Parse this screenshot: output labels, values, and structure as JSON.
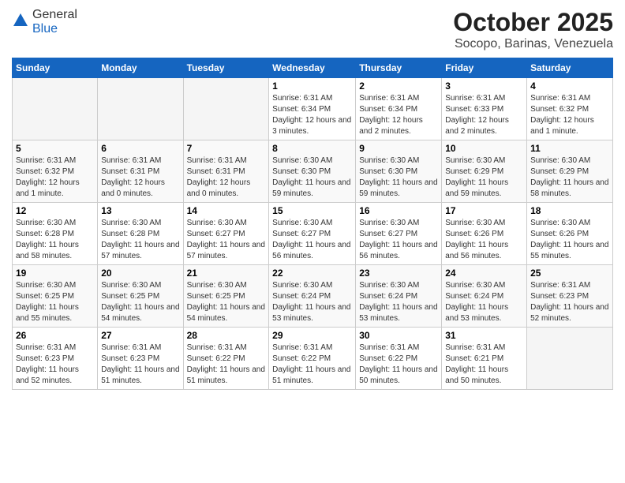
{
  "header": {
    "logo_general": "General",
    "logo_blue": "Blue",
    "month_title": "October 2025",
    "subtitle": "Socopo, Barinas, Venezuela"
  },
  "weekdays": [
    "Sunday",
    "Monday",
    "Tuesday",
    "Wednesday",
    "Thursday",
    "Friday",
    "Saturday"
  ],
  "weeks": [
    [
      {
        "day": "",
        "info": "",
        "empty": true
      },
      {
        "day": "",
        "info": "",
        "empty": true
      },
      {
        "day": "",
        "info": "",
        "empty": true
      },
      {
        "day": "1",
        "info": "Sunrise: 6:31 AM\nSunset: 6:34 PM\nDaylight: 12 hours and 3 minutes.",
        "empty": false
      },
      {
        "day": "2",
        "info": "Sunrise: 6:31 AM\nSunset: 6:34 PM\nDaylight: 12 hours and 2 minutes.",
        "empty": false
      },
      {
        "day": "3",
        "info": "Sunrise: 6:31 AM\nSunset: 6:33 PM\nDaylight: 12 hours and 2 minutes.",
        "empty": false
      },
      {
        "day": "4",
        "info": "Sunrise: 6:31 AM\nSunset: 6:32 PM\nDaylight: 12 hours and 1 minute.",
        "empty": false
      }
    ],
    [
      {
        "day": "5",
        "info": "Sunrise: 6:31 AM\nSunset: 6:32 PM\nDaylight: 12 hours and 1 minute.",
        "empty": false
      },
      {
        "day": "6",
        "info": "Sunrise: 6:31 AM\nSunset: 6:31 PM\nDaylight: 12 hours and 0 minutes.",
        "empty": false
      },
      {
        "day": "7",
        "info": "Sunrise: 6:31 AM\nSunset: 6:31 PM\nDaylight: 12 hours and 0 minutes.",
        "empty": false
      },
      {
        "day": "8",
        "info": "Sunrise: 6:30 AM\nSunset: 6:30 PM\nDaylight: 11 hours and 59 minutes.",
        "empty": false
      },
      {
        "day": "9",
        "info": "Sunrise: 6:30 AM\nSunset: 6:30 PM\nDaylight: 11 hours and 59 minutes.",
        "empty": false
      },
      {
        "day": "10",
        "info": "Sunrise: 6:30 AM\nSunset: 6:29 PM\nDaylight: 11 hours and 59 minutes.",
        "empty": false
      },
      {
        "day": "11",
        "info": "Sunrise: 6:30 AM\nSunset: 6:29 PM\nDaylight: 11 hours and 58 minutes.",
        "empty": false
      }
    ],
    [
      {
        "day": "12",
        "info": "Sunrise: 6:30 AM\nSunset: 6:28 PM\nDaylight: 11 hours and 58 minutes.",
        "empty": false
      },
      {
        "day": "13",
        "info": "Sunrise: 6:30 AM\nSunset: 6:28 PM\nDaylight: 11 hours and 57 minutes.",
        "empty": false
      },
      {
        "day": "14",
        "info": "Sunrise: 6:30 AM\nSunset: 6:27 PM\nDaylight: 11 hours and 57 minutes.",
        "empty": false
      },
      {
        "day": "15",
        "info": "Sunrise: 6:30 AM\nSunset: 6:27 PM\nDaylight: 11 hours and 56 minutes.",
        "empty": false
      },
      {
        "day": "16",
        "info": "Sunrise: 6:30 AM\nSunset: 6:27 PM\nDaylight: 11 hours and 56 minutes.",
        "empty": false
      },
      {
        "day": "17",
        "info": "Sunrise: 6:30 AM\nSunset: 6:26 PM\nDaylight: 11 hours and 56 minutes.",
        "empty": false
      },
      {
        "day": "18",
        "info": "Sunrise: 6:30 AM\nSunset: 6:26 PM\nDaylight: 11 hours and 55 minutes.",
        "empty": false
      }
    ],
    [
      {
        "day": "19",
        "info": "Sunrise: 6:30 AM\nSunset: 6:25 PM\nDaylight: 11 hours and 55 minutes.",
        "empty": false
      },
      {
        "day": "20",
        "info": "Sunrise: 6:30 AM\nSunset: 6:25 PM\nDaylight: 11 hours and 54 minutes.",
        "empty": false
      },
      {
        "day": "21",
        "info": "Sunrise: 6:30 AM\nSunset: 6:25 PM\nDaylight: 11 hours and 54 minutes.",
        "empty": false
      },
      {
        "day": "22",
        "info": "Sunrise: 6:30 AM\nSunset: 6:24 PM\nDaylight: 11 hours and 53 minutes.",
        "empty": false
      },
      {
        "day": "23",
        "info": "Sunrise: 6:30 AM\nSunset: 6:24 PM\nDaylight: 11 hours and 53 minutes.",
        "empty": false
      },
      {
        "day": "24",
        "info": "Sunrise: 6:30 AM\nSunset: 6:24 PM\nDaylight: 11 hours and 53 minutes.",
        "empty": false
      },
      {
        "day": "25",
        "info": "Sunrise: 6:31 AM\nSunset: 6:23 PM\nDaylight: 11 hours and 52 minutes.",
        "empty": false
      }
    ],
    [
      {
        "day": "26",
        "info": "Sunrise: 6:31 AM\nSunset: 6:23 PM\nDaylight: 11 hours and 52 minutes.",
        "empty": false
      },
      {
        "day": "27",
        "info": "Sunrise: 6:31 AM\nSunset: 6:23 PM\nDaylight: 11 hours and 51 minutes.",
        "empty": false
      },
      {
        "day": "28",
        "info": "Sunrise: 6:31 AM\nSunset: 6:22 PM\nDaylight: 11 hours and 51 minutes.",
        "empty": false
      },
      {
        "day": "29",
        "info": "Sunrise: 6:31 AM\nSunset: 6:22 PM\nDaylight: 11 hours and 51 minutes.",
        "empty": false
      },
      {
        "day": "30",
        "info": "Sunrise: 6:31 AM\nSunset: 6:22 PM\nDaylight: 11 hours and 50 minutes.",
        "empty": false
      },
      {
        "day": "31",
        "info": "Sunrise: 6:31 AM\nSunset: 6:21 PM\nDaylight: 11 hours and 50 minutes.",
        "empty": false
      },
      {
        "day": "",
        "info": "",
        "empty": true
      }
    ]
  ]
}
